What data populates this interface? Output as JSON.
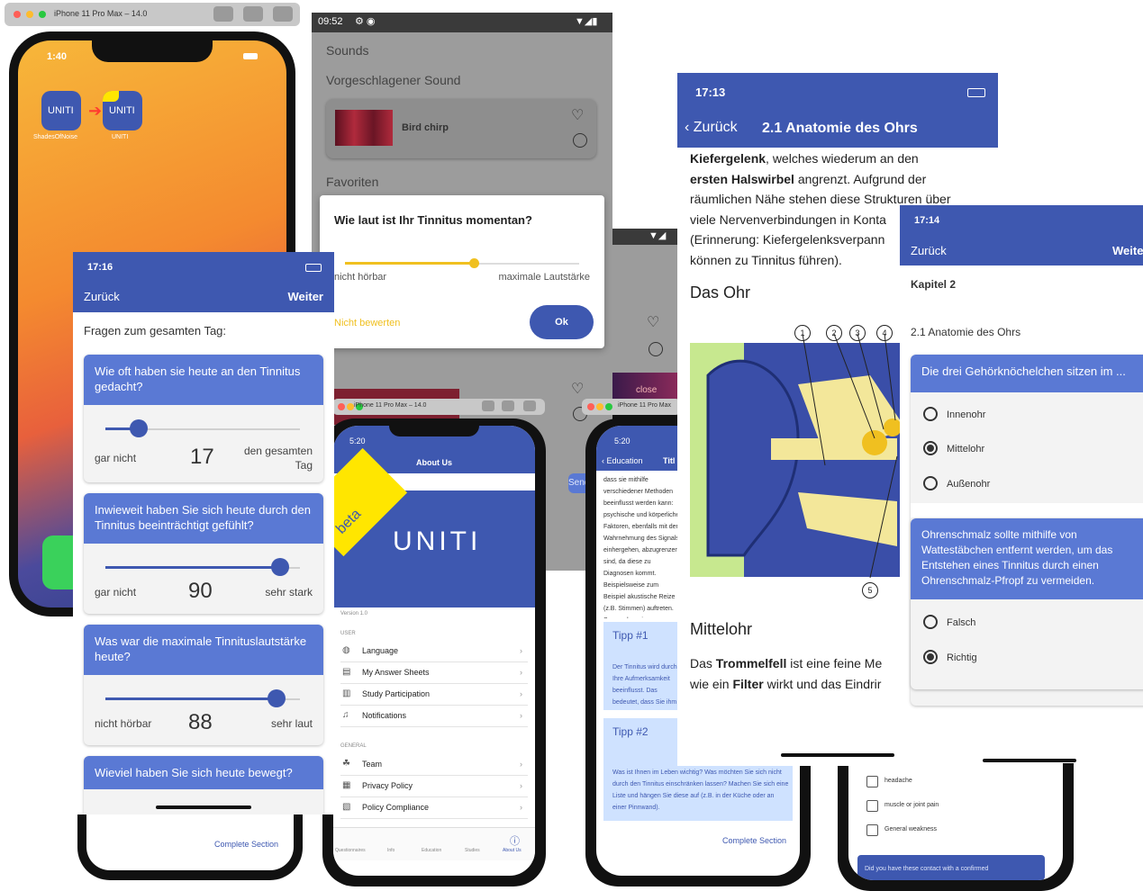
{
  "sim1": {
    "mac_title": "iPhone 11 Pro Max – 14.0",
    "time": "1:40",
    "apps": [
      {
        "name": "ShadesOfNoise",
        "logo": "UNITI"
      },
      {
        "name": "UNITI",
        "logo": "UNITI"
      }
    ]
  },
  "android": {
    "time": "09:52",
    "section_sounds": "Sounds",
    "section_suggested": "Vorgeschlagener Sound",
    "sound_name": "Bird chirp",
    "section_favorites": "Favoriten",
    "dialog": {
      "title": "Wie laut ist Ihr Tinnitus momentan?",
      "value": 0.55,
      "min_label": "nicht hörbar",
      "max_label": "maximale Lautstärke",
      "skip": "Nicht bewerten",
      "ok": "Ok"
    },
    "close": "close",
    "send": "Sende"
  },
  "questionnaire": {
    "time": "17:16",
    "back": "Zurück",
    "next": "Weiter",
    "heading": "Fragen zum gesamten Tag:",
    "questions": [
      {
        "q": "Wie oft haben sie heute an den Tinnitus gedacht?",
        "min": "gar nicht",
        "value": "17",
        "max": "den gesamten Tag",
        "fraction": 0.17
      },
      {
        "q": "Inwieweit haben Sie sich heute durch den Tinnitus beeinträchtigt gefühlt?",
        "min": "gar nicht",
        "value": "90",
        "max": "sehr stark",
        "fraction": 0.9
      },
      {
        "q": "Was war die maximale Tinnituslautstärke heute?",
        "min": "nicht hörbar",
        "value": "88",
        "max": "sehr laut",
        "fraction": 0.88
      },
      {
        "q": "Wieviel haben Sie sich heute bewegt?"
      }
    ],
    "complete": "Complete Section"
  },
  "about": {
    "mac_title": "iPhone 11 Pro Max – 14.0",
    "time": "5:20",
    "title": "About Us",
    "beta": "beta",
    "logo": "UNITI",
    "version": "Version 1.0",
    "user_header": "USER",
    "user_items": [
      "Language",
      "My Answer Sheets",
      "Study Participation",
      "Notifications"
    ],
    "general_header": "GENERAL",
    "general_items": [
      "Team",
      "Privacy Policy",
      "Policy Compliance"
    ],
    "tabs": [
      "Questionnaires",
      "Info",
      "Education",
      "Studies",
      "About Us"
    ]
  },
  "education": {
    "mac_title": "iPhone 11 Pro Max",
    "time": "5:20",
    "back": "Education",
    "title_cut": "Titl",
    "body": "dass sie mithilfe verschiedener Methoden beeinflusst werden kann: psychische und körperliche Faktoren, ebenfalls mit der Wahrnehmung des Signals einhergehen, abzugrenzen sind, da diese zu Diagnosen kommt. Beispielsweise zum Beispiel akustische Reize (z.B. Stimmen) auftreten. Songs, den wir morgens gehört haben und der uns den Tag begleitet: Tinnitus.",
    "tipp1_title": "Tipp #1",
    "tipp1_text": "Der Tinnitus wird durch Ihre Aufmerksamkeit beeinflusst. Das bedeutet, dass Sie ihm zumessen, wie wahr!",
    "tipp2_title": "Tipp #2",
    "tipp2_text": "Was ist Ihnen im Leben wichtig? Was möchten Sie sich nicht durch den Tinnitus einschränken lassen? Machen Sie sich eine Liste und hängen Sie diese auf (z.B. in der Küche oder an einer Pinnwand).",
    "complete": "Complete Section"
  },
  "anatomy": {
    "time": "17:13",
    "back": "Zurück",
    "title": "2.1 Anatomie des Ohrs",
    "para1_bold1": "Kiefergelenk",
    "para1_a": ", welches wiederum an den",
    "para1_bold2": "ersten Halswirbel",
    "para1_b": " angrenzt. Aufgrund der",
    "para1_c": "räumlichen Nähe stehen diese Strukturen über",
    "para1_d": "viele Nervenverbindungen in Konta",
    "para1_e": "(Erinnerung: Kiefergelenksverpann",
    "para1_f": "können zu Tinnitus führen).",
    "h_ohr": "Das Ohr",
    "markers": [
      "1",
      "2",
      "3",
      "4",
      "5"
    ],
    "h_mittelohr": "Mittelohr",
    "para2_a": "Das ",
    "para2_bold1": "Trommelfell",
    "para2_b": " ist eine feine Me",
    "para2_c": "wie ein ",
    "para2_bold2": "Filter",
    "para2_d": " wirkt und das Eindrir"
  },
  "quiz": {
    "time": "17:14",
    "back": "Zurück",
    "next": "Weite",
    "chapter": "Kapitel 2",
    "section": "2.1 Anatomie des Ohrs",
    "q1": "Die drei Gehörknöchelchen sitzen im ...",
    "q1_options": [
      "Innenohr",
      "Mittelohr",
      "Außenohr"
    ],
    "q2": "Ohrenschmalz sollte mithilfe von Wattestäbchen entfernt werden, um das Entstehen eines Tinnitus durch einen Ohrenschmalz-Pfropf zu vermeiden.",
    "q2_options": [
      "Falsch",
      "Richtig"
    ]
  },
  "symptoms": {
    "items": [
      "headache",
      "muscle or joint pain",
      "General weakness"
    ],
    "footer": "Did you have these contact with a confirmed"
  }
}
